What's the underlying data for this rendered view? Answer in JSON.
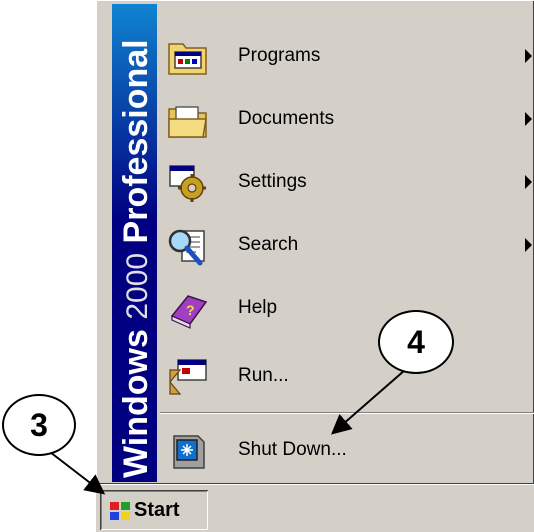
{
  "banner": {
    "brand": "Windows",
    "version": "2000",
    "edition": "Professional"
  },
  "menu_items": [
    {
      "label": "Programs",
      "icon": "programs-folder-icon",
      "has_submenu": true
    },
    {
      "label": "Documents",
      "icon": "documents-folder-icon",
      "has_submenu": true
    },
    {
      "label": "Settings",
      "icon": "settings-gear-icon",
      "has_submenu": true
    },
    {
      "label": "Search",
      "icon": "search-magnifier-icon",
      "has_submenu": true
    },
    {
      "label": "Help",
      "icon": "help-book-icon",
      "has_submenu": false
    },
    {
      "label": "Run...",
      "icon": "run-window-icon",
      "has_submenu": false
    },
    {
      "label": "Shut Down...",
      "icon": "shut-down-icon",
      "has_submenu": false
    }
  ],
  "taskbar": {
    "start_label": "Start"
  },
  "callouts": {
    "three": "3",
    "four": "4"
  },
  "colors": {
    "menu_bg": "#d4d0c8",
    "banner": "#000080"
  }
}
